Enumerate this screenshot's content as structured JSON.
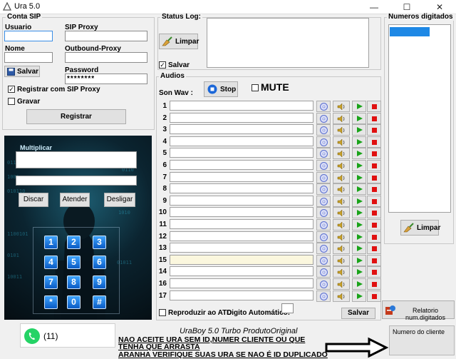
{
  "window": {
    "title": "Ura 5.0",
    "minimize": "—",
    "maximize": "☐",
    "close": "✕"
  },
  "conta_sip": {
    "group_label": "Conta SIP",
    "usuario_label": "Usuario",
    "usuario_value": "",
    "sip_proxy_label": "SIP Proxy",
    "sip_proxy_value": "",
    "nome_label": "Nome",
    "nome_value": "",
    "outbound_label": "Outbound-Proxy",
    "outbound_value": "",
    "salvar_label": "Salvar",
    "password_label": "Password",
    "password_value": "********",
    "registrar_sip_label": "Registrar com SIP Proxy",
    "registrar_sip_checked": true,
    "gravar_label": "Gravar",
    "gravar_checked": false,
    "registrar_button": "Registrar"
  },
  "status_log": {
    "group_label": "Status Log:",
    "limpar_label": "Limpar",
    "salvar_label": "Salvar",
    "salvar_checked": true
  },
  "numeros": {
    "group_label": "Numeros digitados",
    "limpar_label": "Limpar"
  },
  "phone": {
    "multiplicar_label": "Multiplicar",
    "discar": "Discar",
    "atender": "Atender",
    "desligar": "Desligar",
    "keys": [
      "1",
      "2",
      "3",
      "4",
      "5",
      "6",
      "7",
      "8",
      "9",
      "*",
      "0",
      "#"
    ]
  },
  "audios": {
    "group_label": "Audios",
    "son_wav_label": "Son Wav :",
    "stop_label": "Stop",
    "mute_label": "MUTE",
    "mute_checked": false,
    "rows": [
      {
        "num": "1",
        "value": ""
      },
      {
        "num": "2",
        "value": ""
      },
      {
        "num": "3",
        "value": ""
      },
      {
        "num": "4",
        "value": ""
      },
      {
        "num": "5",
        "value": ""
      },
      {
        "num": "6",
        "value": ""
      },
      {
        "num": "7",
        "value": ""
      },
      {
        "num": "8",
        "value": ""
      },
      {
        "num": "9",
        "value": ""
      },
      {
        "num": "10",
        "value": ""
      },
      {
        "num": "11",
        "value": ""
      },
      {
        "num": "12",
        "value": ""
      },
      {
        "num": "13",
        "value": ""
      },
      {
        "num": "15",
        "value": "",
        "highlight": true
      },
      {
        "num": "14",
        "value": ""
      },
      {
        "num": "16",
        "value": ""
      },
      {
        "num": "17",
        "value": ""
      }
    ],
    "reproduzir_label": "Reproduzir ao  ATD",
    "digito_label": "Digito Automático:",
    "digito_value": "",
    "salvar_label": "Salvar",
    "relatorio_label": "Relatorio num.digitados"
  },
  "footer": {
    "whatsapp_number": "(11)",
    "brand": "UraBoy 5.0 Turbo ProdutoOriginal",
    "note_lines": [
      "NAO ACEITE URA SEM ID,NUMER CLIENTE OU QUE",
      "TENHA QUE ARRASTA",
      "ARANHA VERIFIQUE SUAS URA SE NAO É ID DUPLICADO"
    ],
    "numero_cliente_label": "Numero do cliente",
    "numero_cliente_value": ""
  },
  "colors": {
    "accent": "#1e88e5",
    "play": "#19a319",
    "stop": "#e01010",
    "whatsapp": "#25d366"
  }
}
